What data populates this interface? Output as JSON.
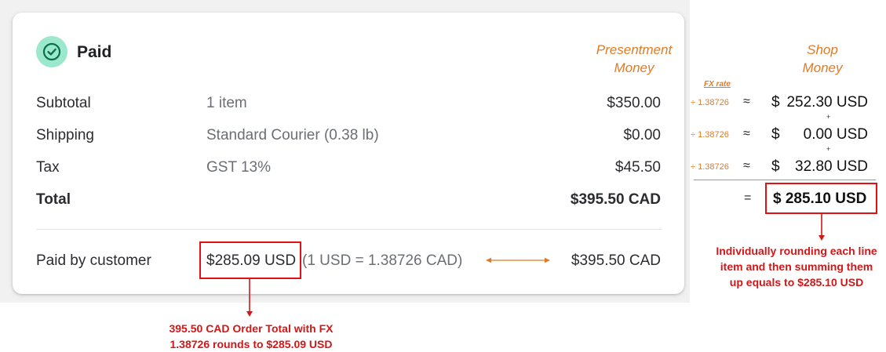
{
  "status": {
    "label": "Paid",
    "icon": "check-circle-icon"
  },
  "columns": {
    "presentment_line1": "Presentment",
    "presentment_line2": "Money",
    "shop_line1": "Shop",
    "shop_line2": "Money"
  },
  "rows": [
    {
      "label": "Subtotal",
      "description": "1 item",
      "amount": "$350.00"
    },
    {
      "label": "Shipping",
      "description": "Standard Courier (0.38 lb)",
      "amount": "$0.00"
    },
    {
      "label": "Tax",
      "description": "GST 13%",
      "amount": "$45.50"
    }
  ],
  "total": {
    "label": "Total",
    "amount": "$395.50 CAD"
  },
  "paid_by_customer": {
    "label": "Paid by customer",
    "usd_amount": "$285.09 USD",
    "fx_note": "(1 USD = 1.38726 CAD)",
    "amount": "$395.50 CAD"
  },
  "fx_panel": {
    "header": "FX rate",
    "lines": [
      {
        "rate": "÷ 1.38726",
        "approx": "≈",
        "dollar": "$",
        "value": "252.30 USD"
      },
      {
        "rate": "÷ 1.38726",
        "approx": "≈",
        "dollar": "$",
        "value": "0.00 USD"
      },
      {
        "rate": "÷ 1.38726",
        "approx": "≈",
        "dollar": "$",
        "value": "32.80 USD"
      }
    ],
    "plus": "+",
    "equals": "=",
    "sum": "$ 285.10 USD"
  },
  "annotations": {
    "left_line1": "395.50 CAD Order Total with FX",
    "left_line2": "1.38726 rounds to $285.09 USD",
    "right_line1": "Individually rounding each line",
    "right_line2": "item and then summing them",
    "right_line3": "up equals to $285.10 USD"
  },
  "colors": {
    "accent_orange": "#e07b24",
    "annotation_red": "#d01818",
    "badge_green": "#9be8cc",
    "check_dark_green": "#0a6e4f"
  }
}
